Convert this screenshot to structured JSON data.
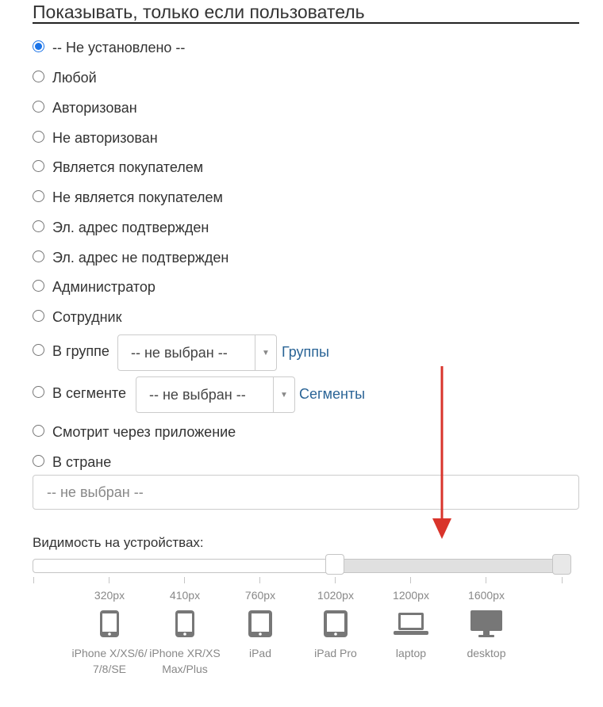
{
  "section": {
    "title": "Показывать, только если пользователь"
  },
  "options": [
    {
      "label": "-- Не установлено --",
      "checked": true
    },
    {
      "label": "Любой",
      "checked": false
    },
    {
      "label": "Авторизован",
      "checked": false
    },
    {
      "label": "Не авторизован",
      "checked": false
    },
    {
      "label": "Является покупателем",
      "checked": false
    },
    {
      "label": "Не является покупателем",
      "checked": false
    },
    {
      "label": "Эл. адрес подтвержден",
      "checked": false
    },
    {
      "label": "Эл. адрес не подтвержден",
      "checked": false
    },
    {
      "label": "Администратор",
      "checked": false
    },
    {
      "label": "Сотрудник",
      "checked": false
    },
    {
      "label": "В группе",
      "checked": false
    },
    {
      "label": "В сегменте",
      "checked": false
    },
    {
      "label": "Смотрит через приложение",
      "checked": false
    },
    {
      "label": "В стране",
      "checked": false
    }
  ],
  "group_select": {
    "value": "-- не выбран --",
    "link": "Группы"
  },
  "segment_select": {
    "value": "-- не выбран --",
    "link": "Сегменты"
  },
  "country_select": {
    "placeholder": "-- не выбран --"
  },
  "devices": {
    "label": "Видимость на устройствах:",
    "range_fraction": [
      0.56,
      1.0
    ],
    "items": [
      {
        "px": "320px",
        "icon": "phone-icon",
        "label": "iPhone X/XS/6/ 7/8/SE"
      },
      {
        "px": "410px",
        "icon": "phone-icon",
        "label": "iPhone XR/XS Max/Plus"
      },
      {
        "px": "760px",
        "icon": "tablet-icon",
        "label": "iPad"
      },
      {
        "px": "1020px",
        "icon": "tablet-icon",
        "label": "iPad Pro"
      },
      {
        "px": "1200px",
        "icon": "laptop-icon",
        "label": "laptop"
      },
      {
        "px": "1600px",
        "icon": "desktop-icon",
        "label": "desktop"
      }
    ]
  },
  "colors": {
    "accent": "#1a73e8",
    "link": "#2a6496",
    "annotation_arrow": "#d9342b"
  }
}
